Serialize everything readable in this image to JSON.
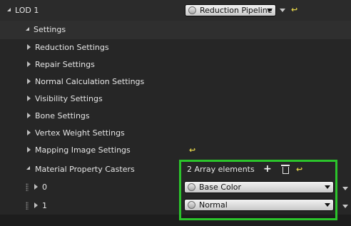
{
  "lod": {
    "title": "LOD 1"
  },
  "pipeline": {
    "label": "Reduction Pipeline",
    "icon": "reset-arrow-icon"
  },
  "settings": {
    "header": "Settings",
    "items": [
      "Reduction Settings",
      "Repair Settings",
      "Normal Calculation Settings",
      "Visibility Settings",
      "Bone Settings",
      "Vertex Weight Settings",
      "Mapping Image Settings"
    ]
  },
  "casters": {
    "label": "Material Property Casters",
    "count_text": "2 Array elements",
    "elements": [
      {
        "index": "0",
        "value": "Base Color"
      },
      {
        "index": "1",
        "value": "Normal"
      }
    ]
  },
  "colors": {
    "highlight": "#2bc42b",
    "reset": "#e0d04a"
  }
}
